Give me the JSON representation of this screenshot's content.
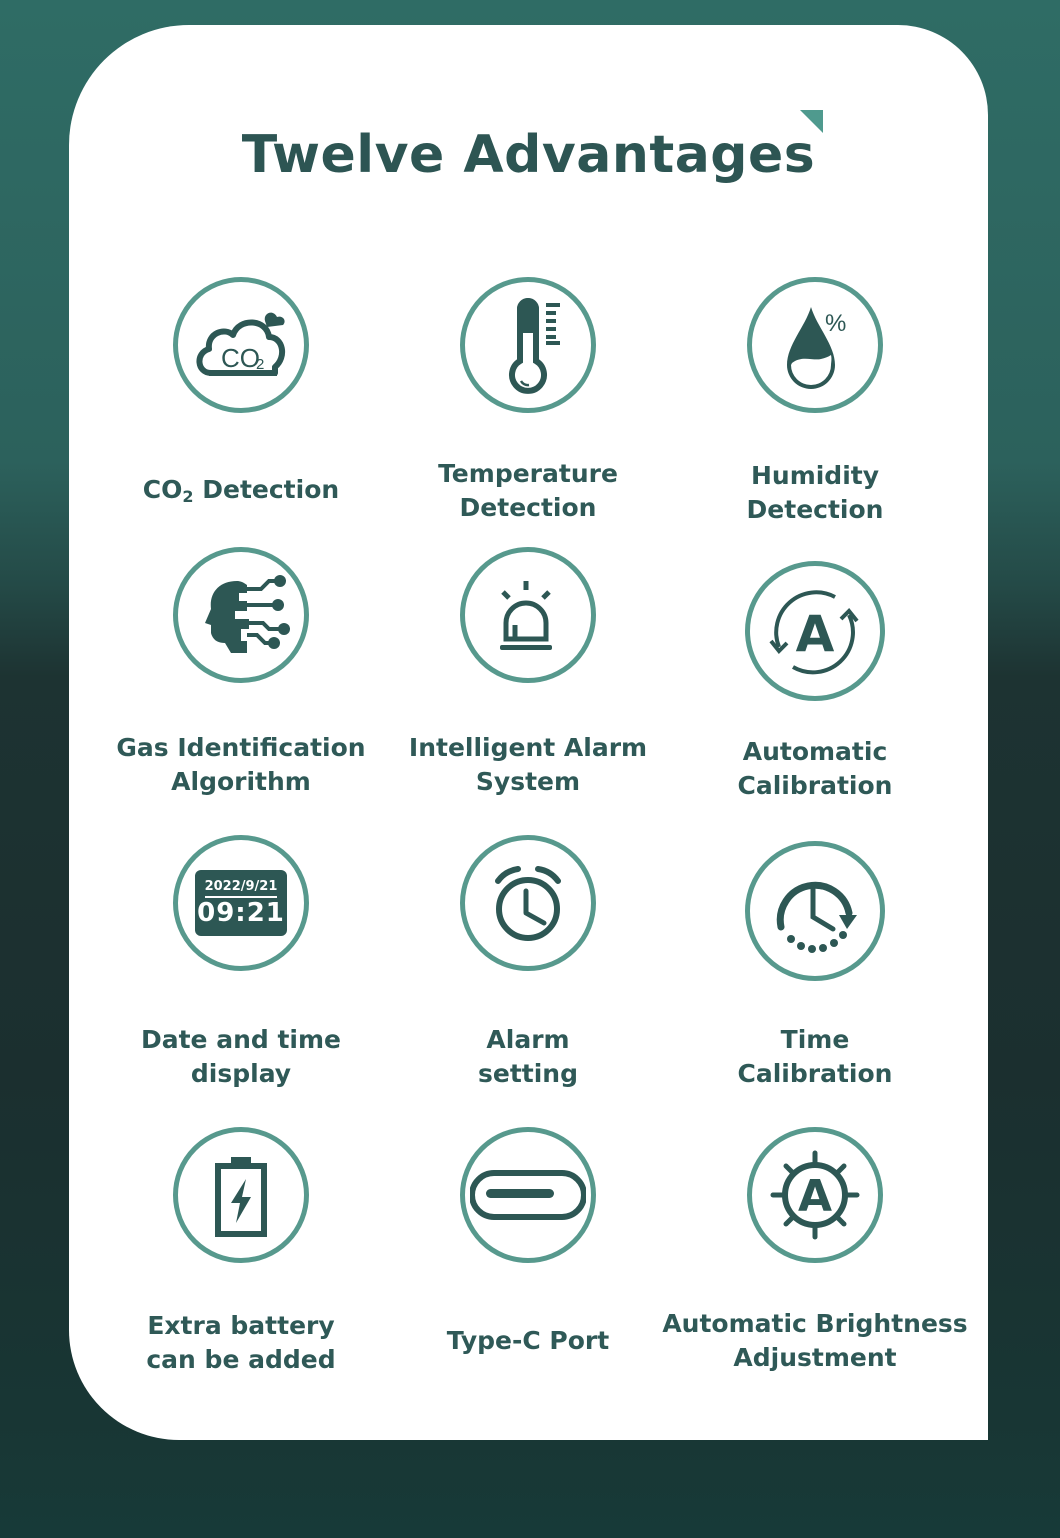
{
  "title": "Twelve Advantages",
  "colors": {
    "ring": "#57998d",
    "icon": "#2d5754",
    "text": "#2f5957",
    "card": "#ffffff",
    "accent_triangle": "#4f9a8e"
  },
  "features": [
    {
      "icon": "co2-cloud-icon",
      "label_line1": "CO",
      "label_sub": "2",
      "label_rest": " Detection",
      "icon_text": "CO",
      "icon_sub": "2"
    },
    {
      "icon": "thermometer-icon",
      "label_line1": "Temperature",
      "label_line2": "Detection"
    },
    {
      "icon": "humidity-drop-icon",
      "label_line1": "Humidity",
      "label_line2": "Detection",
      "icon_text": "%"
    },
    {
      "icon": "ai-head-circuit-icon",
      "label_line1": "Gas Identification",
      "label_line2": "Algorithm"
    },
    {
      "icon": "alarm-beacon-icon",
      "label_line1": "Intelligent Alarm",
      "label_line2": "System"
    },
    {
      "icon": "auto-calibration-icon",
      "label_line1": "Automatic",
      "label_line2": "Calibration",
      "icon_text": "A"
    },
    {
      "icon": "date-time-display-icon",
      "label_line1": "Date and time",
      "label_line2": "display",
      "icon_date": "2022/9/21",
      "icon_time": "09:21"
    },
    {
      "icon": "alarm-clock-icon",
      "label_line1": "Alarm",
      "label_line2": "setting"
    },
    {
      "icon": "time-calibration-icon",
      "label_line1": "Time",
      "label_line2": "Calibration"
    },
    {
      "icon": "battery-charging-icon",
      "label_line1": "Extra battery",
      "label_line2": "can be added"
    },
    {
      "icon": "usb-type-c-icon",
      "label_line1": "Type-C Port"
    },
    {
      "icon": "auto-brightness-icon",
      "label_line1": "Automatic Brightness",
      "label_line2": "Adjustment",
      "icon_text": "A"
    }
  ]
}
